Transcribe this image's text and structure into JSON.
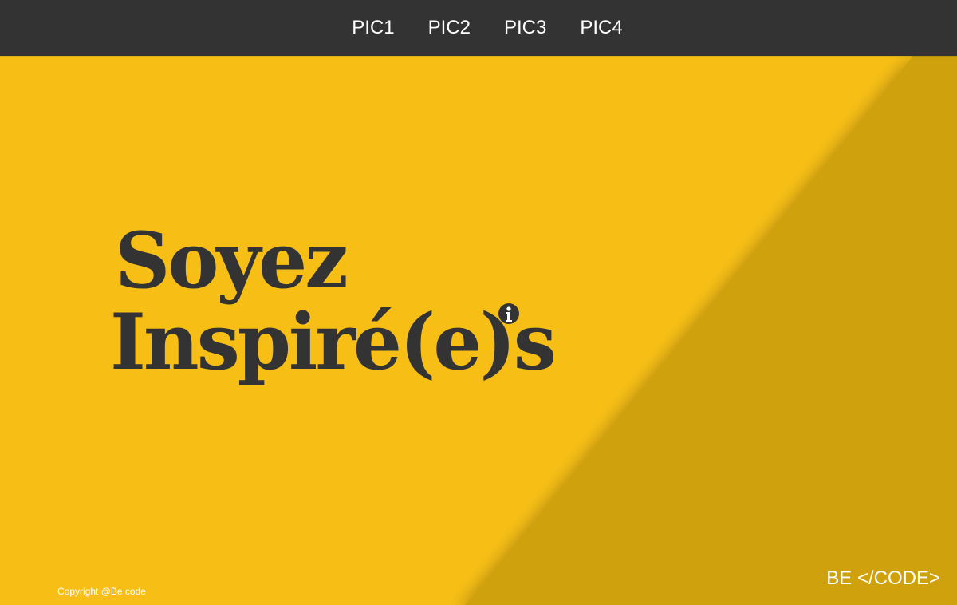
{
  "nav": {
    "items": [
      {
        "label": "PIC1"
      },
      {
        "label": "PIC2"
      },
      {
        "label": "PIC3"
      },
      {
        "label": "PIC4"
      }
    ]
  },
  "hero": {
    "line1": "Soyez",
    "line2": "Inspiré(e)s"
  },
  "footer": {
    "copyright": "Copyright @Be code",
    "brand": "BE </CODE>"
  },
  "colors": {
    "background": "#f7bf16",
    "dark_panel": "#cfa10d",
    "navbar": "#333333",
    "text_dark": "#333333",
    "text_light": "#ffffff"
  },
  "icons": {
    "info": "info-icon"
  }
}
